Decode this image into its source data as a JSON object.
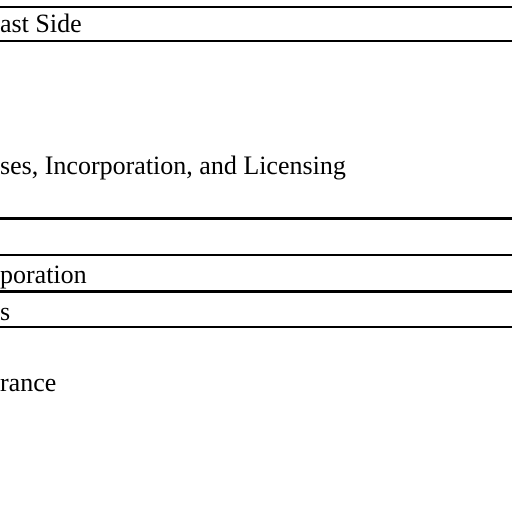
{
  "document": {
    "lines": [
      {
        "text": "ast Side"
      },
      {
        "text": "ses, Incorporation, and Licensing"
      },
      {
        "text": "poration"
      },
      {
        "text": "s"
      },
      {
        "text": "rance"
      }
    ]
  }
}
